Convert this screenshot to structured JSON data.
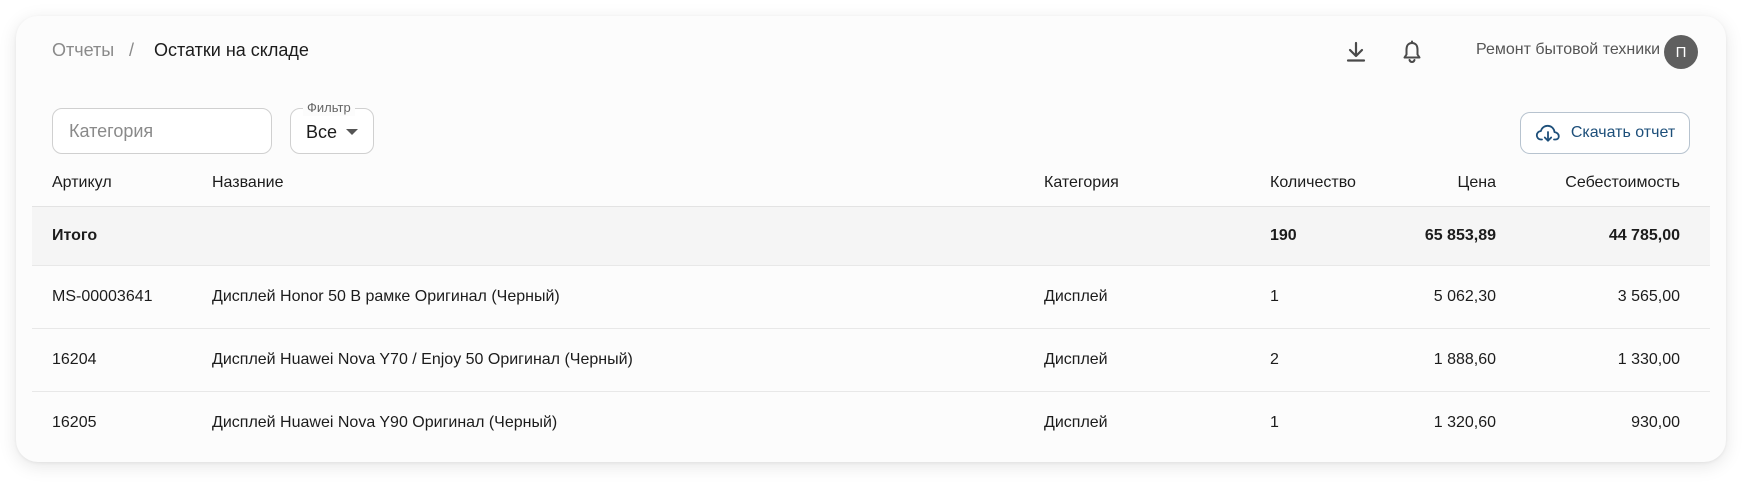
{
  "breadcrumb": {
    "root": "Отчеты",
    "separator": "/",
    "current": "Остатки на складе"
  },
  "header": {
    "icons": [
      "download-icon",
      "bell-icon"
    ],
    "company": "Ремонт бытовой техники",
    "avatar_initial": "П"
  },
  "filters": {
    "category_placeholder": "Категория",
    "filter_label": "Фильтр",
    "filter_value": "Все",
    "download_label": "Скачать отчет"
  },
  "colors": {
    "accent": "#1d4f7a",
    "avatar_bg": "#5f5f5f",
    "total_row_bg": "#f5f5f5"
  },
  "table": {
    "columns": {
      "sku": "Артикул",
      "name": "Название",
      "category": "Категория",
      "quantity": "Количество",
      "price": "Цена",
      "cost": "Себестоимость"
    },
    "total": {
      "label": "Итого",
      "quantity": "190",
      "price": "65 853,89",
      "cost": "44 785,00"
    },
    "rows": [
      {
        "sku": "MS-00003641",
        "name": "Дисплей Honor 50 В рамке Оригинал (Черный)",
        "category": "Дисплей",
        "quantity": "1",
        "price": "5 062,30",
        "cost": "3 565,00"
      },
      {
        "sku": "16204",
        "name": "Дисплей Huawei Nova Y70 / Enjoy 50 Оригинал (Черный)",
        "category": "Дисплей",
        "quantity": "2",
        "price": "1 888,60",
        "cost": "1 330,00"
      },
      {
        "sku": "16205",
        "name": "Дисплей Huawei Nova Y90 Оригинал (Черный)",
        "category": "Дисплей",
        "quantity": "1",
        "price": "1 320,60",
        "cost": "930,00"
      }
    ]
  }
}
